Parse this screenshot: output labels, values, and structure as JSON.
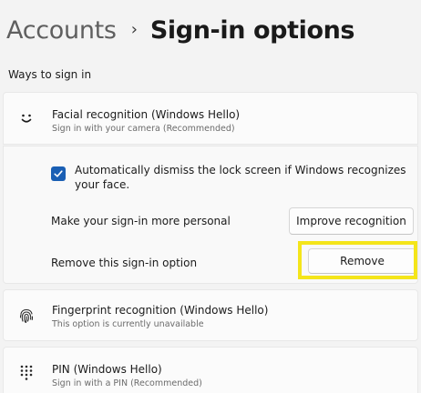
{
  "breadcrumb": {
    "parent": "Accounts",
    "separator": "›",
    "current": "Sign-in options"
  },
  "section_label": "Ways to sign in",
  "colors": {
    "checkbox_accent": "#1a5fb4",
    "highlight": "#f4e51a"
  },
  "facial": {
    "icon": "smile-face-icon",
    "title": "Facial recognition (Windows Hello)",
    "subtitle": "Sign in with your camera (Recommended)",
    "dismiss_checked": true,
    "dismiss_label": "Automatically dismiss the lock screen if Windows recognizes your face.",
    "personal_label": "Make your sign-in more personal",
    "improve_button": "Improve recognition",
    "remove_label": "Remove this sign-in option",
    "remove_button": "Remove"
  },
  "fingerprint": {
    "icon": "fingerprint-icon",
    "title": "Fingerprint recognition (Windows Hello)",
    "subtitle": "This option is currently unavailable"
  },
  "pin": {
    "icon": "pin-keypad-icon",
    "title": "PIN (Windows Hello)",
    "subtitle": "Sign in with a PIN (Recommended)"
  }
}
